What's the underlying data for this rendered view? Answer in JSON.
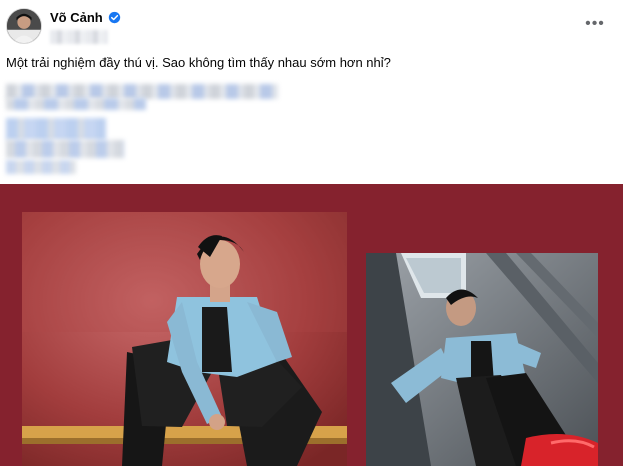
{
  "post": {
    "author_name": "Võ Cảnh",
    "text": "Một trải nghiệm đầy thú vị. Sao không tìm thấy nhau sớm hơn nhỉ?",
    "more_label": "•••"
  },
  "icons": {
    "verified": "verified-badge-icon",
    "more": "more-options-icon"
  },
  "colors": {
    "panel_background": "#85222e",
    "verified_blue": "#1877f2",
    "text": "#050505"
  }
}
